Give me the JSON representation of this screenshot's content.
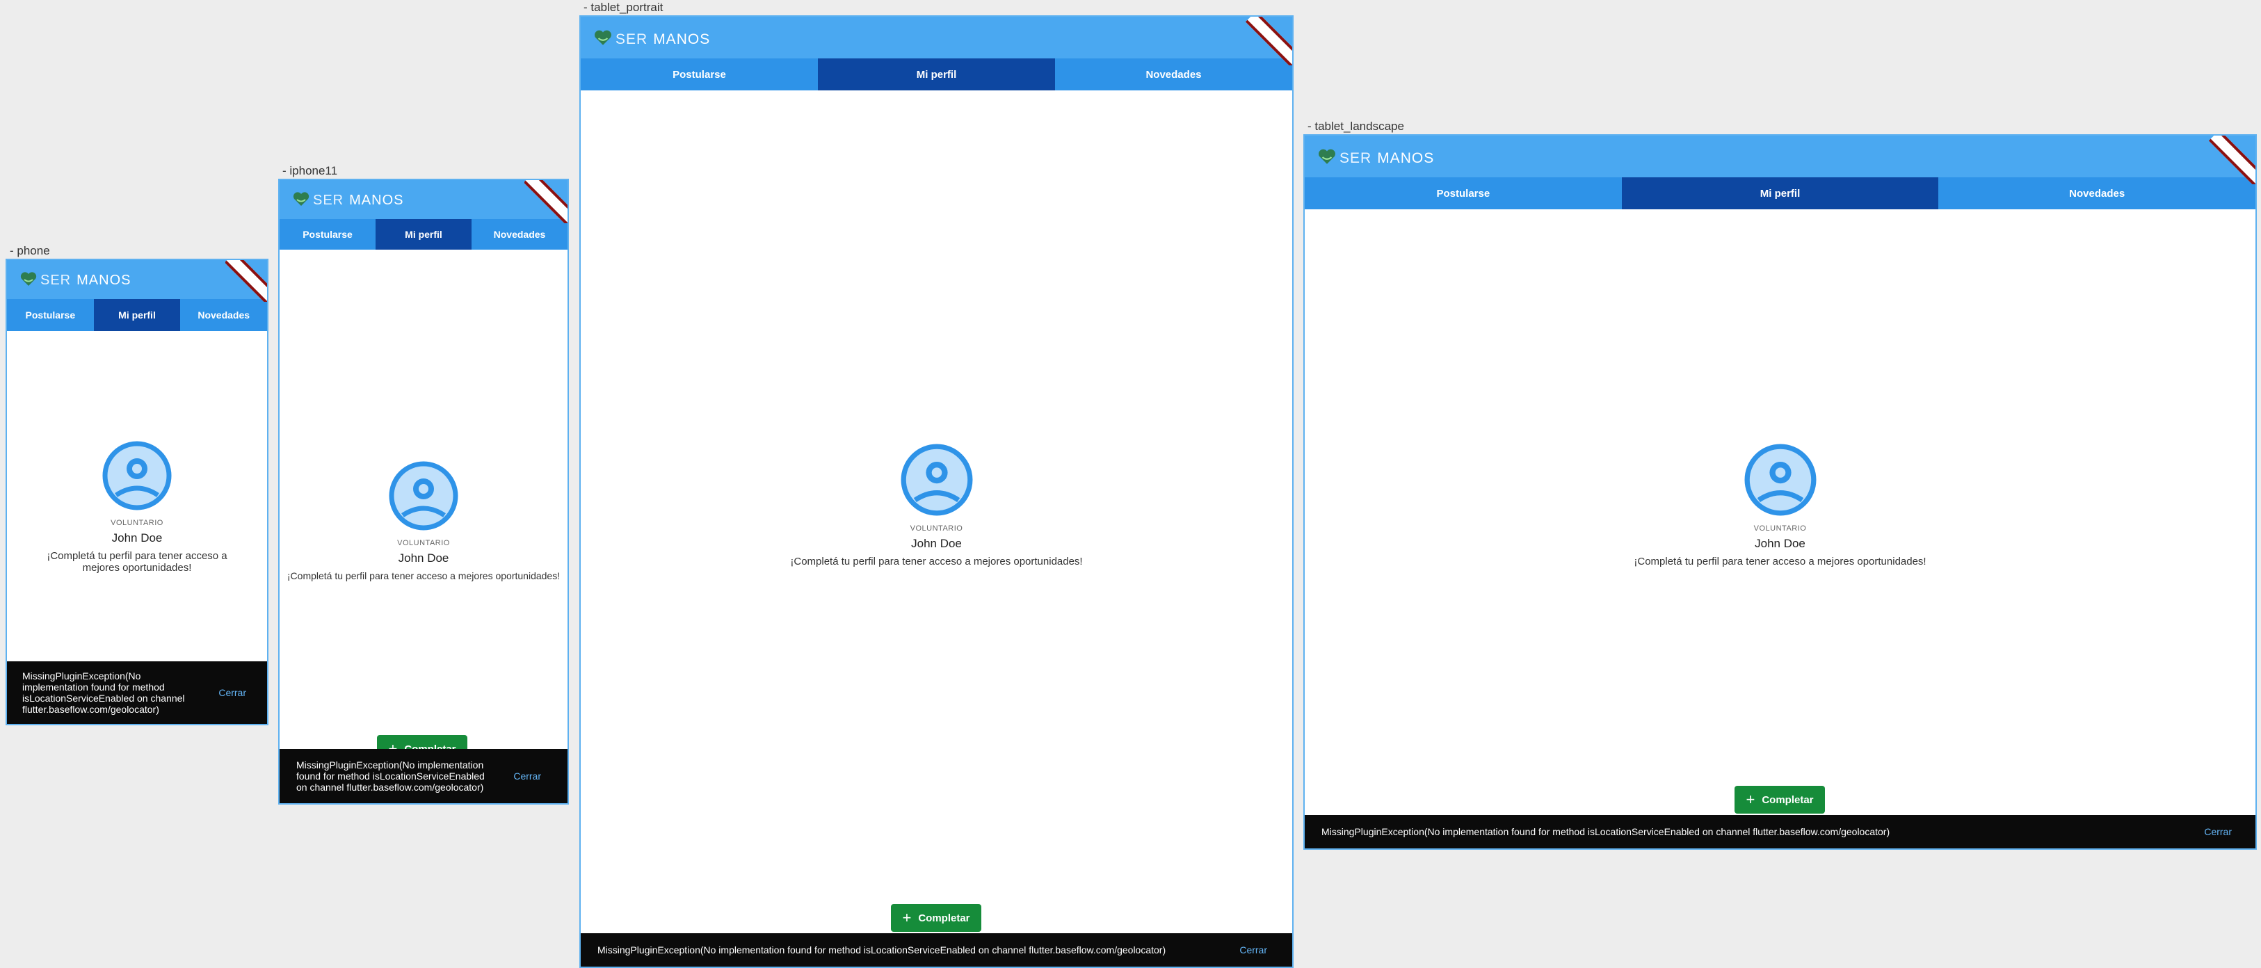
{
  "app": {
    "logo_ser": "SER",
    "logo_manos": "MANOS",
    "tabs": [
      "Postularse",
      "Mi perfil",
      "Novedades"
    ],
    "profile": {
      "role": "VOLUNTARIO",
      "name": "John Doe",
      "message": "¡Completá tu perfil para tener acceso a mejores oportunidades!"
    },
    "complete_button": "Completar",
    "snackbar": {
      "message": "MissingPluginException(No implementation found for method isLocationServiceEnabled on channel flutter.baseflow.com/geolocator)",
      "close": "Cerrar"
    }
  },
  "devices": {
    "phone": "- phone",
    "iphone11": "- iphone11",
    "tablet_portrait": "- tablet_portrait",
    "tablet_landscape": "- tablet_landscape"
  },
  "colors": {
    "appbar": "#4aa8f1",
    "tabs": "#2e93e8",
    "tab_active": "#0d47a1",
    "button": "#168c3a",
    "snackbar": "#0b0b0b",
    "close_text": "#64b5f6",
    "avatar": "#2e93e8"
  },
  "icons": [
    "heart-hands-logo-icon",
    "account-circle-icon",
    "plus-icon",
    "debug-banner-icon"
  ]
}
